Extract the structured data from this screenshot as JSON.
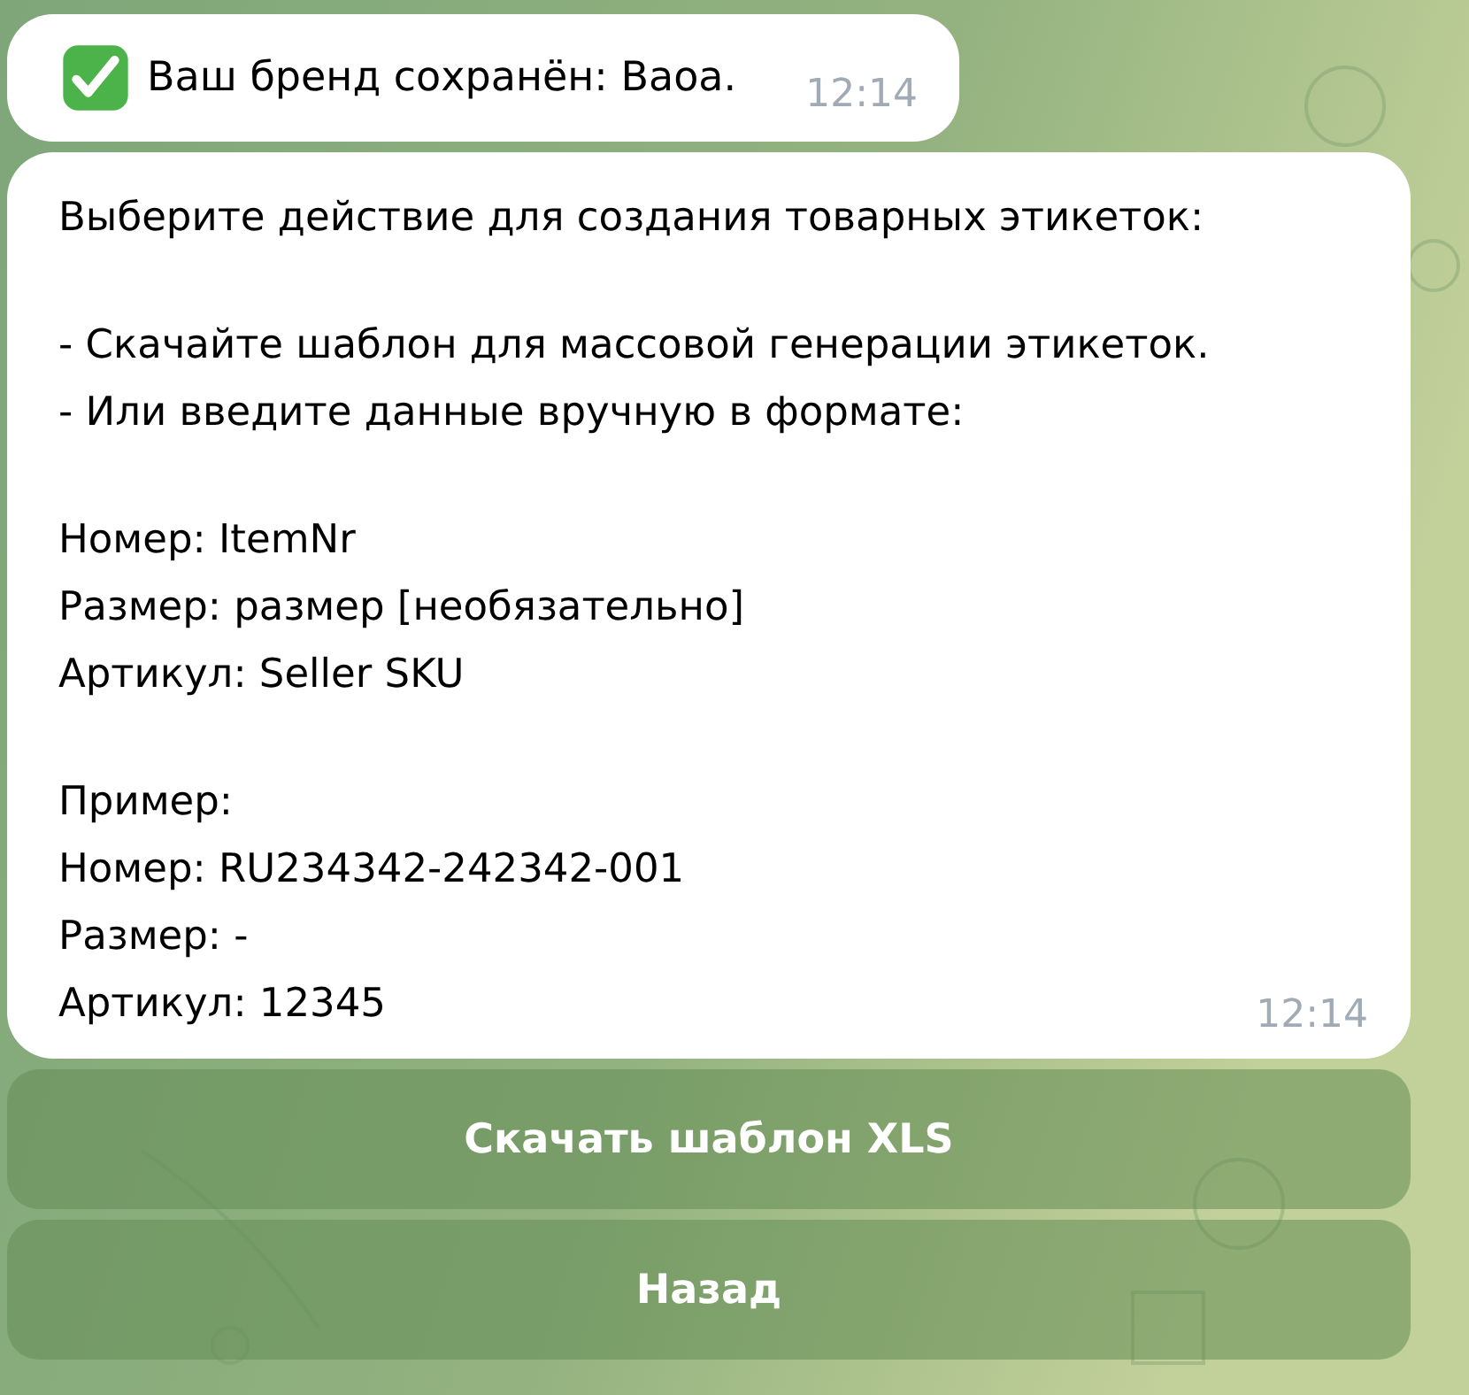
{
  "messages": [
    {
      "kind": "status",
      "text": "Ваш бренд сохранён: Baoa.",
      "time": "12:14"
    },
    {
      "kind": "text",
      "paragraphs": [
        "Выберите действие для создания товарных этикеток:",
        "- Скачайте шаблон для массовой генерации этикеток.\n- Или введите данные вручную в формате:",
        "Номер: ItemNr\nРазмер: размер [необязательно]\nАртикул: Seller SKU",
        "Пример:\nНомер: RU234342-242342-001\nРазмер: -\nАртикул: 12345"
      ],
      "time": "12:14"
    }
  ],
  "keyboard": [
    {
      "label": "Скачать шаблон XLS"
    },
    {
      "label": "Назад"
    }
  ]
}
